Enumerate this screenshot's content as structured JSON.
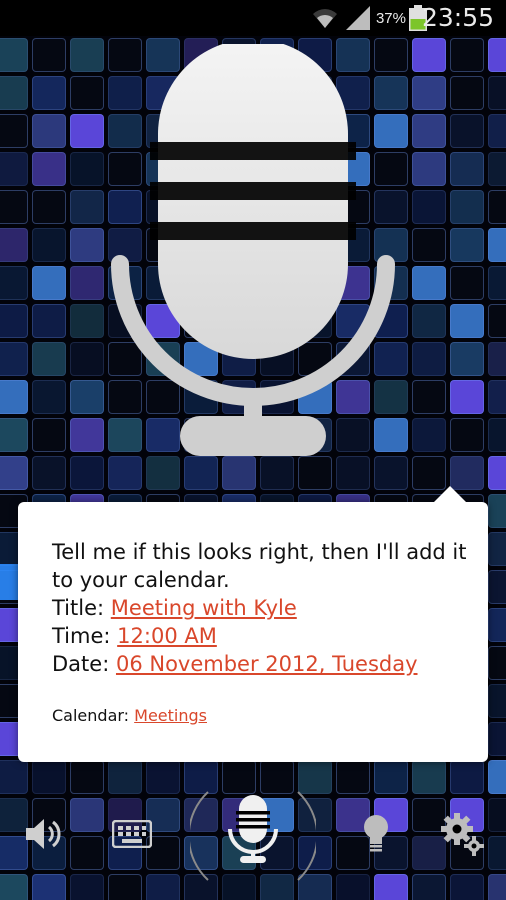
{
  "status_bar": {
    "battery_percent": "37%",
    "time": "23:55"
  },
  "dialog": {
    "message": "Tell me if this looks right, then I'll add it to your calendar.",
    "title_label": "Title:",
    "title_value": "Meeting with Kyle",
    "time_label": "Time:",
    "time_value": "12:00 AM",
    "date_label": "Date:",
    "date_value": "06 November 2012, Tuesday",
    "calendar_label": "Calendar:",
    "calendar_value": "Meetings"
  },
  "toolbar": {
    "icons": [
      "speaker-icon",
      "keyboard-icon",
      "microphone-icon",
      "lightbulb-icon",
      "settings-icon"
    ]
  },
  "colors": {
    "link": "#d9472b",
    "dialog_bg": "#ffffff",
    "icon": "#cfcfcf"
  }
}
